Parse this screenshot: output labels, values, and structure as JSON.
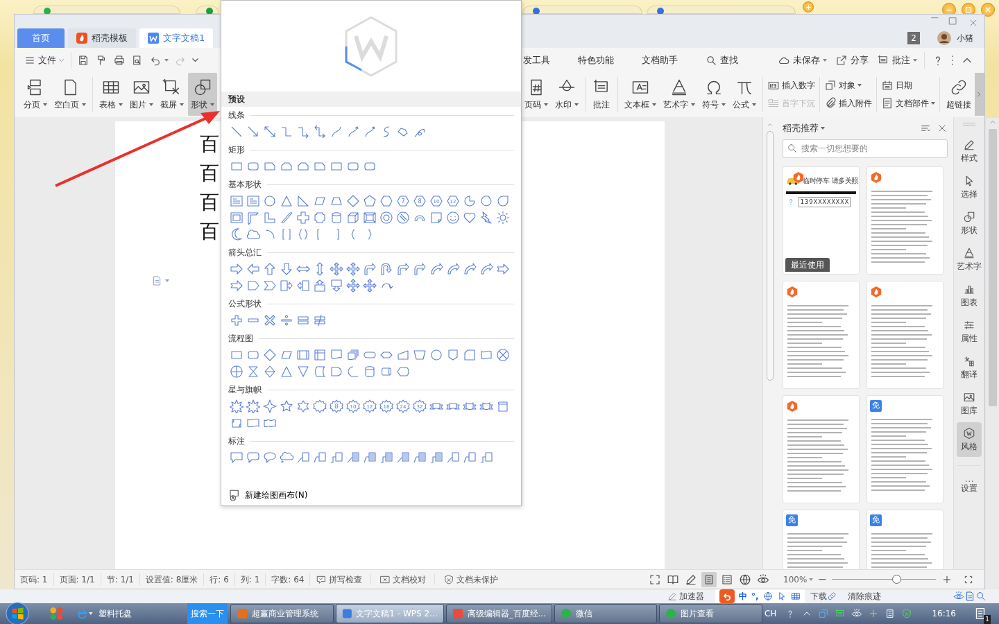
{
  "window": {
    "tabs": [
      {
        "label": "首页",
        "kind": "home",
        "selected": false
      },
      {
        "label": "稻壳模板",
        "kind": "template",
        "selected": false
      },
      {
        "label": "文字文稿1",
        "kind": "document",
        "selected": true
      }
    ],
    "badge": "2",
    "user": "小猪"
  },
  "menu_bar": {
    "file": "文件",
    "tabs": [
      {
        "label": "发工具"
      },
      {
        "label": "特色功能"
      },
      {
        "label": "文档助手"
      }
    ],
    "find": "查找",
    "actions": [
      {
        "label": "未保存",
        "dropdown": true
      },
      {
        "label": "分享",
        "dropdown": false
      },
      {
        "label": "批注",
        "dropdown": true
      }
    ]
  },
  "ribbon": {
    "left": [
      {
        "kind": "large",
        "items": [
          {
            "label": "分页",
            "dropdown": true,
            "selected": false
          },
          {
            "label": "空白页",
            "dropdown": true,
            "selected": false
          }
        ]
      },
      {
        "kind": "large",
        "items": [
          {
            "label": "表格",
            "dropdown": true,
            "selected": false
          },
          {
            "label": "图片",
            "dropdown": true,
            "selected": false
          },
          {
            "label": "截屏",
            "dropdown": true,
            "selected": false
          },
          {
            "label": "形状",
            "dropdown": true,
            "selected": true
          }
        ]
      }
    ],
    "right": [
      {
        "kind": "large",
        "items": [
          {
            "label": "页码",
            "dropdown": true,
            "selected": false
          },
          {
            "label": "水印",
            "dropdown": true,
            "selected": false
          }
        ]
      },
      {
        "kind": "large",
        "items": [
          {
            "label": "批注",
            "dropdown": false,
            "selected": false
          }
        ]
      },
      {
        "kind": "large",
        "items": [
          {
            "label": "文本框",
            "dropdown": true,
            "selected": false
          },
          {
            "label": "艺术字",
            "dropdown": true,
            "selected": false
          },
          {
            "label": "符号",
            "dropdown": true,
            "selected": false
          },
          {
            "label": "公式",
            "dropdown": true,
            "selected": false
          }
        ]
      },
      {
        "kind": "stack",
        "items": [
          {
            "label": "插入数字",
            "dropdown": false,
            "disabled": false
          },
          {
            "label": "首字下沉",
            "dropdown": false,
            "disabled": true
          }
        ]
      },
      {
        "kind": "stack",
        "items": [
          {
            "label": "对象",
            "dropdown": true,
            "disabled": false
          },
          {
            "label": "插入附件",
            "dropdown": false,
            "disabled": false
          }
        ]
      },
      {
        "kind": "stack",
        "items": [
          {
            "label": "日期",
            "dropdown": false,
            "disabled": false
          },
          {
            "label": "文档部件",
            "dropdown": true,
            "disabled": false
          }
        ]
      },
      {
        "kind": "large",
        "items": [
          {
            "label": "超链接",
            "dropdown": false,
            "selected": false
          }
        ]
      }
    ]
  },
  "document": {
    "lines": [
      "百",
      "百",
      "百",
      "百"
    ]
  },
  "shapes_menu": {
    "header": "预设",
    "sections": [
      {
        "title": "线条"
      },
      {
        "title": "矩形"
      },
      {
        "title": "基本形状",
        "shape_labels": [
          "7",
          "8",
          "10",
          "12"
        ]
      },
      {
        "title": "箭头总汇"
      },
      {
        "title": "公式形状"
      },
      {
        "title": "流程图"
      },
      {
        "title": "星与旗帜",
        "shape_labels": [
          "8",
          "10",
          "12",
          "16",
          "24",
          "32"
        ]
      },
      {
        "title": "标注"
      }
    ],
    "footer": "新建绘图画布(N)"
  },
  "template_panel": {
    "title": "稻壳推荐",
    "placeholder": "搜索一切您想要的",
    "templates": [
      {
        "kind": "parking",
        "free": false,
        "texts": [
          "临时停车",
          "请多关照",
          "139XXXXXXXX"
        ],
        "tag": "最近使用"
      },
      {
        "kind": "doc",
        "free": false
      },
      {
        "kind": "doc",
        "free": false
      },
      {
        "kind": "doc",
        "free": false
      },
      {
        "kind": "doc",
        "free": false
      },
      {
        "kind": "doc",
        "free": true,
        "badge_text": "免"
      },
      {
        "kind": "doc",
        "free": true,
        "badge_text": "免"
      },
      {
        "kind": "doc",
        "free": true,
        "badge_text": "免"
      }
    ]
  },
  "side_tools": [
    {
      "label": "样式",
      "selected": false
    },
    {
      "label": "选择",
      "selected": false
    },
    {
      "label": "形状",
      "selected": false
    },
    {
      "label": "艺术字",
      "selected": false
    },
    {
      "label": "图表",
      "selected": false
    },
    {
      "label": "属性",
      "selected": false
    },
    {
      "label": "翻译",
      "selected": false
    },
    {
      "label": "图库",
      "selected": false
    },
    {
      "label": "风格",
      "selected": true
    },
    {
      "label": "设置",
      "selected": false
    }
  ],
  "status_bar": {
    "fields": [
      "页码: 1",
      "页面: 1/1",
      "节: 1/1",
      "设置值: 8厘米",
      "行: 6",
      "列: 1",
      "字数: 64"
    ],
    "checks": [
      "拼写检查",
      "文档校对",
      "文档未保护"
    ],
    "views": [
      {
        "selected": false
      },
      {
        "selected": false
      },
      {
        "selected": false
      },
      {
        "selected": true
      },
      {
        "selected": false
      },
      {
        "selected": false
      },
      {
        "selected": false
      }
    ],
    "zoom": "100%",
    "level": 0.62
  },
  "browser_status": {
    "accelerator": "加速器",
    "ime": [
      "中",
      "°,"
    ],
    "download": "下载",
    "clear": "清除痕迹"
  },
  "taskbar": {
    "quick": "塑料托盘",
    "search": "搜索一下",
    "tasks": [
      {
        "label": "超赢商业管理系统",
        "selected": false
      },
      {
        "label": "文字文稿1 - WPS 2...",
        "selected": true
      },
      {
        "label": "高级编辑器_百度经...",
        "selected": false
      },
      {
        "label": "微信",
        "selected": false
      },
      {
        "label": "图片查看",
        "selected": false
      }
    ],
    "lang": "CH",
    "time": "16:16",
    "notifications": "1"
  }
}
